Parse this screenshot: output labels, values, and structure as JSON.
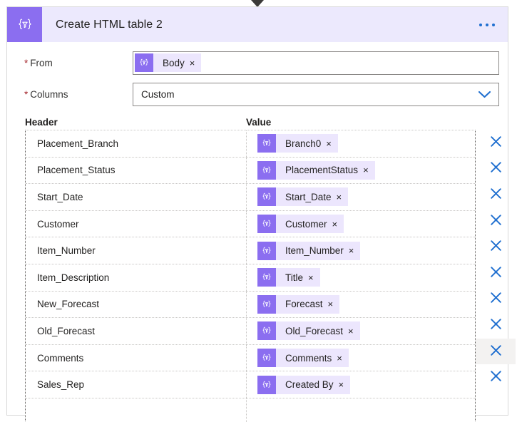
{
  "connector": {
    "arrow_icon": "arrow-down-icon"
  },
  "card": {
    "icon": "data-operations-funnel-icon",
    "title": "Create HTML table 2",
    "overflow_menu_label": "More commands",
    "overflow_icon": "ellipsis-icon"
  },
  "fields": {
    "from": {
      "label": "From",
      "required_marker": "*",
      "token": {
        "label": "Body",
        "icon": "data-operations-funnel-icon",
        "remove_label": "×"
      }
    },
    "columns": {
      "label": "Columns",
      "required_marker": "*",
      "value": "Custom",
      "chevron_icon": "chevron-down-icon"
    }
  },
  "table": {
    "header_caption": "Header",
    "value_caption": "Value",
    "remove_row_icon": "close-icon",
    "token_icon": "data-operations-funnel-icon",
    "token_remove_label": "×",
    "rows": [
      {
        "header": "Placement_Branch",
        "value": "Branch0",
        "hovered": false
      },
      {
        "header": "Placement_Status",
        "value": "PlacementStatus",
        "hovered": false
      },
      {
        "header": "Start_Date",
        "value": "Start_Date",
        "hovered": false
      },
      {
        "header": "Customer",
        "value": "Customer",
        "hovered": false
      },
      {
        "header": "Item_Number",
        "value": "Item_Number",
        "hovered": false
      },
      {
        "header": "Item_Description",
        "value": "Title",
        "hovered": false
      },
      {
        "header": "New_Forecast",
        "value": "Forecast",
        "hovered": false
      },
      {
        "header": "Old_Forecast",
        "value": "Old_Forecast",
        "hovered": false
      },
      {
        "header": "Comments",
        "value": "Comments",
        "hovered": true
      },
      {
        "header": "Sales_Rep",
        "value": "Created By",
        "hovered": false
      },
      {
        "header": "",
        "value": "",
        "hovered": false
      }
    ]
  },
  "colors": {
    "accent_purple": "#8b6ef0",
    "header_bg": "#ece9fd",
    "token_bg": "#ece6fd",
    "link_blue": "#1f6fd0",
    "required_red": "#a4262c",
    "hover_gray": "#f3f2f1"
  }
}
